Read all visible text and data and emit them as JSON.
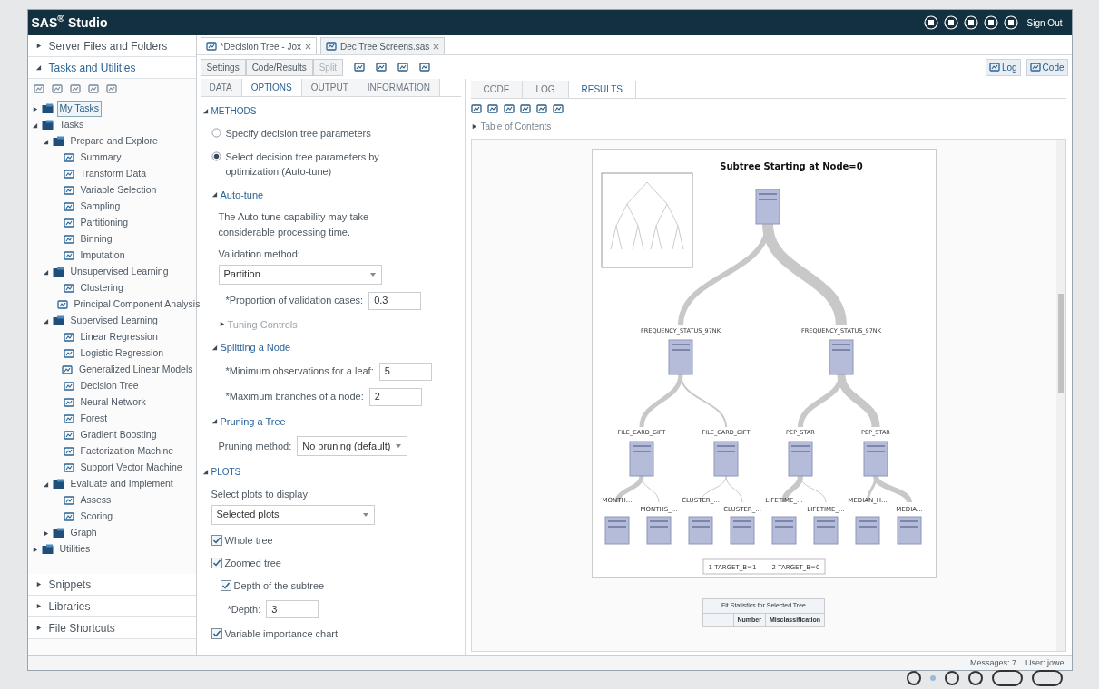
{
  "app": {
    "title": "SAS",
    "title_mark": "®",
    "title_rest": " Studio",
    "sign_out": "Sign Out"
  },
  "left": {
    "sections_top": [
      {
        "label": "Server Files and Folders",
        "expanded": false
      },
      {
        "label": "Tasks and Utilities",
        "expanded": true
      }
    ],
    "tree": [
      {
        "label": "My Tasks",
        "expanded": false,
        "selected": true
      },
      {
        "label": "Tasks",
        "expanded": true,
        "selected": false,
        "children": [
          {
            "label": "Prepare and Explore",
            "expanded": true,
            "selected": false,
            "children": [
              {
                "label": "Summary",
                "selected": false
              },
              {
                "label": "Transform Data",
                "selected": false
              },
              {
                "label": "Variable Selection",
                "selected": false
              },
              {
                "label": "Sampling",
                "selected": false
              },
              {
                "label": "Partitioning",
                "selected": false
              },
              {
                "label": "Binning",
                "selected": false
              },
              {
                "label": "Imputation",
                "selected": false
              }
            ]
          },
          {
            "label": "Unsupervised Learning",
            "expanded": true,
            "selected": false,
            "children": [
              {
                "label": "Clustering",
                "selected": false
              },
              {
                "label": "Principal Component Analysis",
                "selected": false
              }
            ]
          },
          {
            "label": "Supervised Learning",
            "expanded": true,
            "selected": false,
            "children": [
              {
                "label": "Linear Regression",
                "selected": false
              },
              {
                "label": "Logistic Regression",
                "selected": false
              },
              {
                "label": "Generalized Linear Models",
                "selected": false
              },
              {
                "label": "Decision Tree",
                "selected": false
              },
              {
                "label": "Neural Network",
                "selected": false
              },
              {
                "label": "Forest",
                "selected": false
              },
              {
                "label": "Gradient Boosting",
                "selected": false
              },
              {
                "label": "Factorization Machine",
                "selected": false
              },
              {
                "label": "Support Vector Machine",
                "selected": false
              }
            ]
          },
          {
            "label": "Evaluate and Implement",
            "expanded": true,
            "selected": false,
            "children": [
              {
                "label": "Assess",
                "selected": false
              },
              {
                "label": "Scoring",
                "selected": false
              }
            ]
          },
          {
            "label": "Graph",
            "expanded": false,
            "selected": false
          }
        ]
      },
      {
        "label": "Utilities",
        "expanded": false,
        "selected": false
      }
    ],
    "sections_bottom": [
      {
        "label": "Snippets",
        "expanded": false
      },
      {
        "label": "Libraries",
        "expanded": false
      },
      {
        "label": "File Shortcuts",
        "expanded": false
      }
    ]
  },
  "file_tabs": [
    {
      "label": "*Decision Tree - Jox",
      "selected": true
    },
    {
      "label": "Dec Tree Screens.sas",
      "selected": false
    }
  ],
  "modes": [
    {
      "label": "Settings",
      "selected": false,
      "disabled": false
    },
    {
      "label": "Code/Results",
      "selected": false,
      "disabled": false
    },
    {
      "label": "Split",
      "selected": false,
      "disabled": true
    }
  ],
  "option_tabs": [
    {
      "label": "DATA",
      "selected": false
    },
    {
      "label": "OPTIONS",
      "selected": true
    },
    {
      "label": "OUTPUT",
      "selected": false
    },
    {
      "label": "INFORMATION",
      "selected": false
    }
  ],
  "options": [
    {
      "label": "METHODS",
      "expanded": true,
      "items": [
        {
          "kind": "radio",
          "label": "Specify decision tree parameters",
          "selected": false
        },
        {
          "kind": "radio",
          "label": "Select decision tree parameters by optimization (Auto-tune)",
          "selected": true
        },
        {
          "kind": "group",
          "label": "Auto-tune",
          "expanded": true,
          "items": [
            {
              "kind": "note",
              "label": "The Auto-tune capability may take considerable processing time."
            },
            {
              "kind": "select",
              "label": "Validation method:",
              "value": "Partition"
            },
            {
              "kind": "number",
              "label": "*Proportion of validation cases:",
              "value": "0.3"
            },
            {
              "kind": "group",
              "label": "Tuning Controls",
              "expanded": false
            }
          ]
        },
        {
          "kind": "group",
          "label": "Splitting a Node",
          "expanded": true,
          "items": [
            {
              "kind": "number",
              "label": "*Minimum observations for a leaf:",
              "value": "5"
            },
            {
              "kind": "number",
              "label": "*Maximum branches of a node:",
              "value": "2"
            }
          ]
        },
        {
          "kind": "group",
          "label": "Pruning a Tree",
          "expanded": true,
          "items": [
            {
              "kind": "inline_select",
              "label": "Pruning method:",
              "value": "No pruning (default)"
            }
          ]
        }
      ]
    },
    {
      "label": "PLOTS",
      "expanded": true,
      "items": [
        {
          "kind": "select",
          "label": "Select plots to display:",
          "value": "Selected plots"
        },
        {
          "kind": "checkbox",
          "label": "Whole tree",
          "checked": true
        },
        {
          "kind": "checkbox",
          "label": "Zoomed tree",
          "checked": true,
          "items": [
            {
              "kind": "checkbox",
              "label": "Depth of the subtree",
              "checked": true
            },
            {
              "kind": "number",
              "label": "*Depth:",
              "value": "3"
            }
          ]
        },
        {
          "kind": "checkbox",
          "label": "Variable importance chart",
          "checked": true
        }
      ]
    }
  ],
  "view_buttons": [
    "Log",
    "Code"
  ],
  "result_tabs": [
    {
      "label": "CODE",
      "selected": false
    },
    {
      "label": "LOG",
      "selected": false
    },
    {
      "label": "RESULTS",
      "selected": true
    }
  ],
  "toc": {
    "label": "Table of Contents",
    "expanded": false
  },
  "tree_plot": {
    "title": "Subtree Starting at Node=0",
    "level1": [
      "FREQUENCY_STATUS_97NK",
      "FREQUENCY_STATUS_97NK"
    ],
    "level2": [
      "FILE_CARD_GIFT",
      "FILE_CARD_GIFT",
      "PEP_STAR",
      "PEP_STAR"
    ],
    "level3": [
      "MONTH...",
      "MONTHS_...",
      "CLUSTER_...",
      "CLUSTER_...",
      "LIFETIME_...",
      "LIFETIME_...",
      "MEDIAN_H...",
      "MEDIA..."
    ],
    "legend": [
      "1 TARGET_B=1",
      "2 TARGET_B=0"
    ]
  },
  "fit_table": {
    "title": "Fit Statistics for Selected Tree",
    "columns": [
      "Number",
      "Misclassification"
    ]
  },
  "status": [
    "Messages: 7",
    "User: jowei"
  ],
  "carousel": [
    {
      "kind": "dot",
      "selected": false
    },
    {
      "kind": "dot",
      "selected": true
    },
    {
      "kind": "dot",
      "selected": false
    },
    {
      "kind": "dot",
      "selected": false
    },
    {
      "kind": "pill",
      "selected": false
    },
    {
      "kind": "pill",
      "selected": false
    }
  ]
}
